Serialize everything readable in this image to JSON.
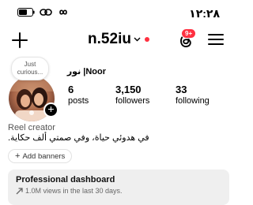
{
  "status_bar": {
    "clock": "١٢:٢٨",
    "icons": [
      "battery-icon",
      "link-icon",
      "infinity-icon"
    ]
  },
  "header": {
    "username": "n.52iu",
    "has_unread_dot": true,
    "notification_badge": "9+",
    "icons": [
      "plus-icon",
      "chevron-down-icon",
      "threads-icon",
      "menu-icon"
    ]
  },
  "profile": {
    "note": "Just curious...",
    "display_name": "نور |Noor",
    "stats": {
      "posts": {
        "value": "6",
        "label": "posts"
      },
      "followers": {
        "value": "3,150",
        "label": "followers"
      },
      "following": {
        "value": "33",
        "label": "following"
      }
    },
    "category": "Reel creator",
    "bio": "في هدوئي حياة، وفي صمتي ألف حكاية.",
    "add_banners_label": "Add banners"
  },
  "dashboard": {
    "title": "Professional dashboard",
    "subtitle": "1.0M views in the last 30 days."
  },
  "colors": {
    "accent_red": "#ff3040",
    "dashboard_bg": "#efefef"
  }
}
